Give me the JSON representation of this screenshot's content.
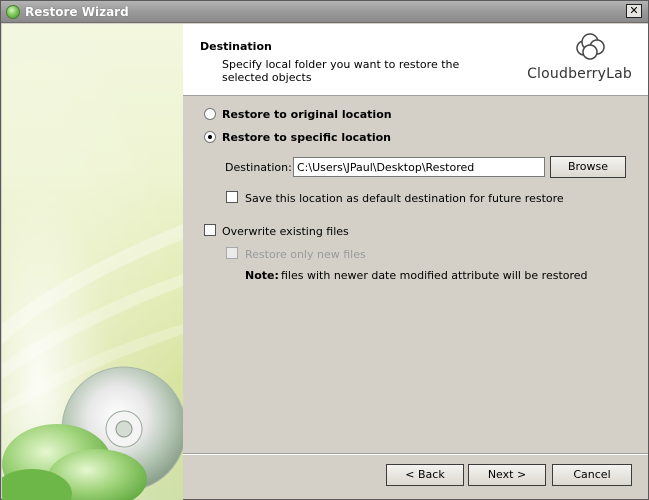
{
  "window": {
    "title": "Restore Wizard",
    "close_glyph": "✕"
  },
  "header": {
    "title": "Destination",
    "subtitle": "Specify local folder you want to restore the selected objects",
    "logo_text": "CloudberryLab"
  },
  "options": {
    "restore_original": "Restore to original location",
    "restore_specific": "Restore to specific location",
    "selected": "restore_specific"
  },
  "destination": {
    "label": "Destination:",
    "value": "C:\\Users\\JPaul\\Desktop\\Restored",
    "browse_label": "Browse",
    "save_default_label": "Save this location as default destination for future restore",
    "save_default_checked": false
  },
  "overwrite": {
    "label": "Overwrite existing files",
    "checked": false,
    "only_new_label": "Restore only new files",
    "only_new_enabled": false,
    "note_label": "Note:",
    "note_text": "files with newer date modified attribute will be restored"
  },
  "footer": {
    "back_label": "< Back",
    "next_label": "Next >",
    "cancel_label": "Cancel"
  },
  "icons": [
    "app-icon",
    "close-icon",
    "cloud-logo-icon",
    "cd-disc-icon"
  ]
}
